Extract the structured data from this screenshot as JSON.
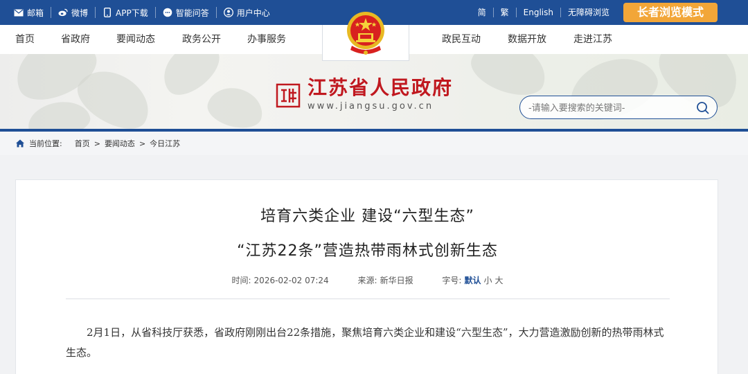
{
  "topbar": {
    "left_items": [
      {
        "label": "邮箱",
        "icon": "mail-icon"
      },
      {
        "label": "微博",
        "icon": "weibo-icon"
      },
      {
        "label": "APP下载",
        "icon": "phone-icon"
      },
      {
        "label": "智能问答",
        "icon": "chat-icon"
      },
      {
        "label": "用户中心",
        "icon": "user-icon"
      }
    ],
    "right_items": [
      "简",
      "繁",
      "English",
      "无障碍浏览"
    ],
    "elder_mode": "长者浏览模式",
    "bar_color": "#1f4f96",
    "elder_color": "#f2a638"
  },
  "nav": {
    "items_left": [
      "首页",
      "省政府",
      "要闻动态",
      "政务公开",
      "办事服务"
    ],
    "items_right": [
      "政民互动",
      "数据开放",
      "走进江苏"
    ]
  },
  "header": {
    "site_name": "江苏省人民政府",
    "site_url": "www.jiangsu.gov.cn",
    "search_placeholder": "-请输入要搜索的关键词-",
    "brand_red": "#c0181f"
  },
  "breadcrumb": {
    "label": "当前位置:",
    "items": [
      "首页",
      "要闻动态",
      "今日江苏"
    ],
    "separator": ">"
  },
  "article": {
    "title_line1": "培育六类企业 建设“六型生态”",
    "title_line2": "“江苏22条”营造热带雨林式创新生态",
    "time_label": "时间:",
    "time_value": "2026-02-02 07:24",
    "source_label": "来源:",
    "source_value": "新华日报",
    "fontsize_label": "字号:",
    "fontsize_options": [
      "默认",
      "小",
      "大"
    ],
    "body": "2月1日，从省科技厅获悉，省政府刚刚出台22条措施，聚焦培育六类企业和建设“六型生态”，大力营造激励创新的热带雨林式生态。"
  }
}
